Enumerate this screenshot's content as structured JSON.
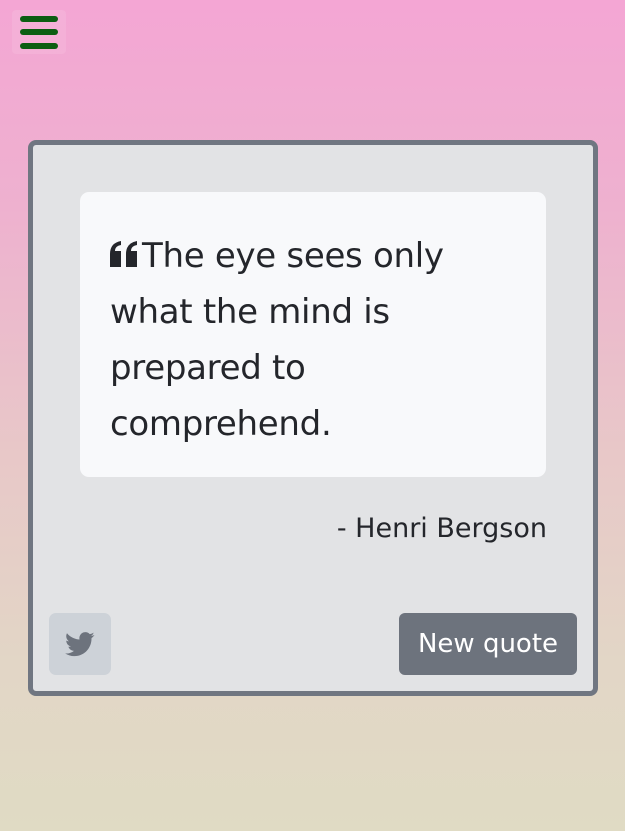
{
  "menu": {
    "icon": "hamburger-menu-icon",
    "color": "#0b5e12"
  },
  "quote": {
    "text": "The eye sees only what the mind is prepared to comprehend.",
    "icon": "quote-left-icon",
    "author": "- Henri Bergson"
  },
  "actions": {
    "tweet_icon": "twitter-icon",
    "new_quote_label": "New quote"
  },
  "colors": {
    "background_top": "#f4a6d4",
    "background_bottom": "#e0dbc4",
    "card_border": "#707681",
    "button_primary": "#6d737d"
  }
}
